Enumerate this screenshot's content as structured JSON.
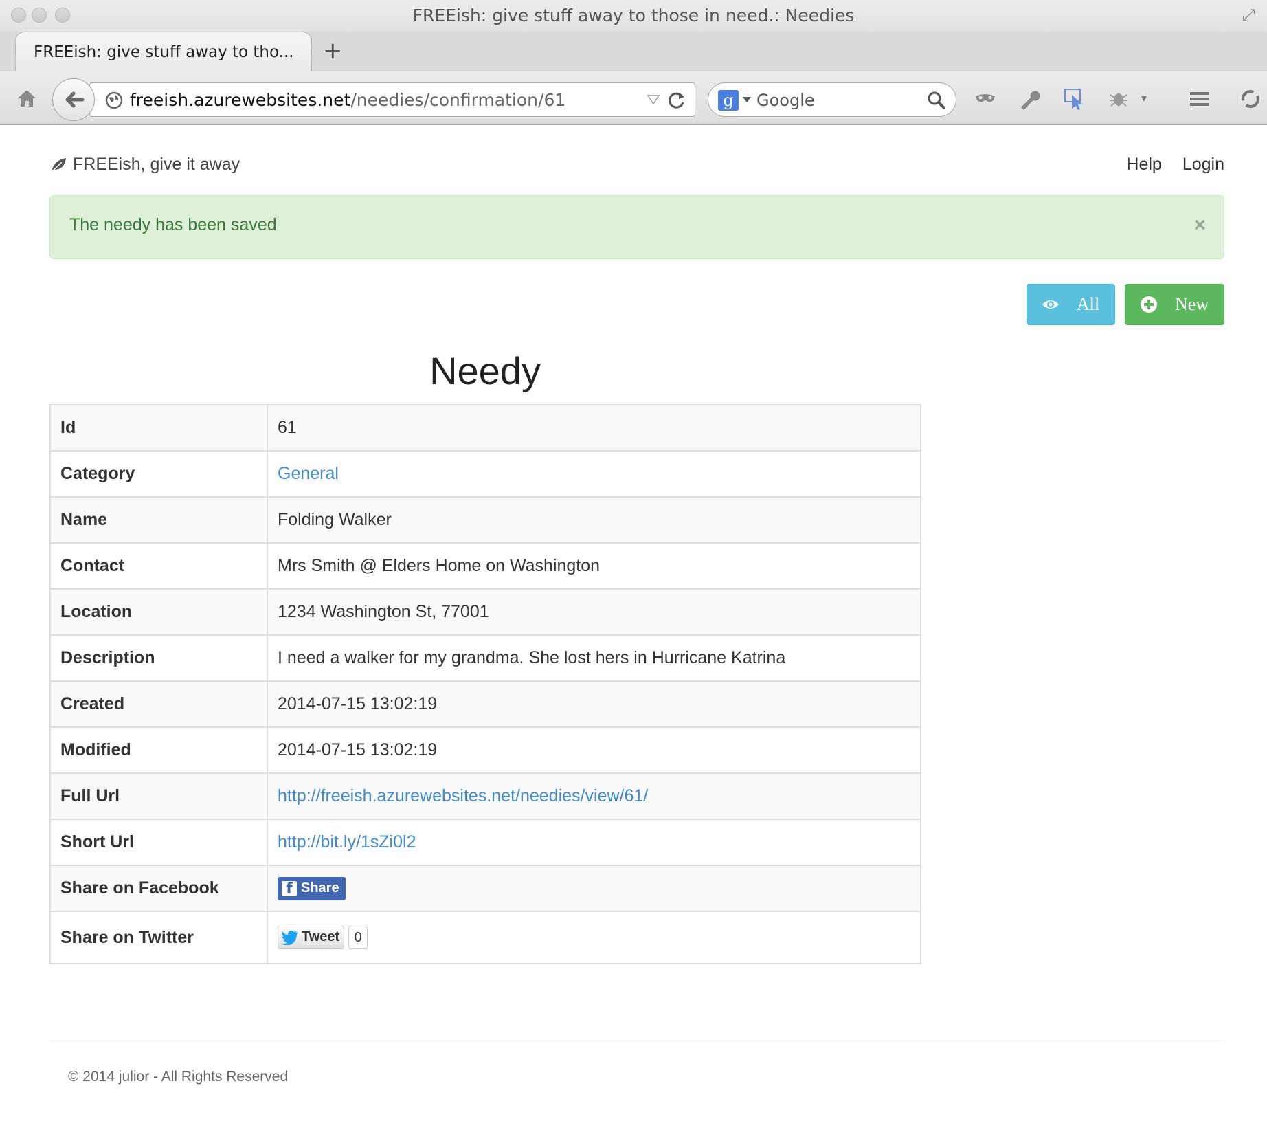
{
  "window": {
    "title": "FREEish: give stuff away to those in need.: Needies"
  },
  "tabs": [
    {
      "label": "FREEish: give stuff away to tho..."
    }
  ],
  "newtab_label": "+",
  "urlbar": {
    "host": "freeish.azurewebsites.net",
    "path": "/needies/confirmation/61"
  },
  "search": {
    "engine_initial": "g",
    "placeholder": "Google"
  },
  "site": {
    "brand": "FREEish, give it away",
    "nav": {
      "help": "Help",
      "login": "Login"
    }
  },
  "alert": {
    "message": "The needy has been saved",
    "close": "×"
  },
  "buttons": {
    "all": "All",
    "new": "New"
  },
  "heading": "Needy",
  "detail": {
    "rows": [
      {
        "key": "Id",
        "value": "61"
      },
      {
        "key": "Category",
        "value": "General"
      },
      {
        "key": "Name",
        "value": "Folding Walker"
      },
      {
        "key": "Contact",
        "value": "Mrs Smith @ Elders Home on Washington"
      },
      {
        "key": "Location",
        "value": "1234 Washington St, 77001"
      },
      {
        "key": "Description",
        "value": "I need a walker for my grandma. She lost hers in Hurricane Katrina"
      },
      {
        "key": "Created",
        "value": "2014-07-15 13:02:19"
      },
      {
        "key": "Modified",
        "value": "2014-07-15 13:02:19"
      },
      {
        "key": "Full Url",
        "value": "http://freeish.azurewebsites.net/needies/view/61/"
      },
      {
        "key": "Short Url",
        "value": "http://bit.ly/1sZi0l2"
      },
      {
        "key": "Share on Facebook",
        "value": "Share"
      },
      {
        "key": "Share on Twitter",
        "value": "Tweet"
      }
    ],
    "tweet_count": "0"
  },
  "footer": "© 2014 julior - All Rights Reserved",
  "colors": {
    "link": "#428bca",
    "alert_bg": "#dff0d8",
    "alert_text": "#3c763d",
    "btn_info": "#5bc0de",
    "btn_success": "#5cb85c",
    "facebook": "#4267b2",
    "twitter": "#1da1f2"
  },
  "icons": {
    "brand": "leaf-icon",
    "all_button": "eye-icon",
    "new_button": "plus-circle-icon"
  }
}
